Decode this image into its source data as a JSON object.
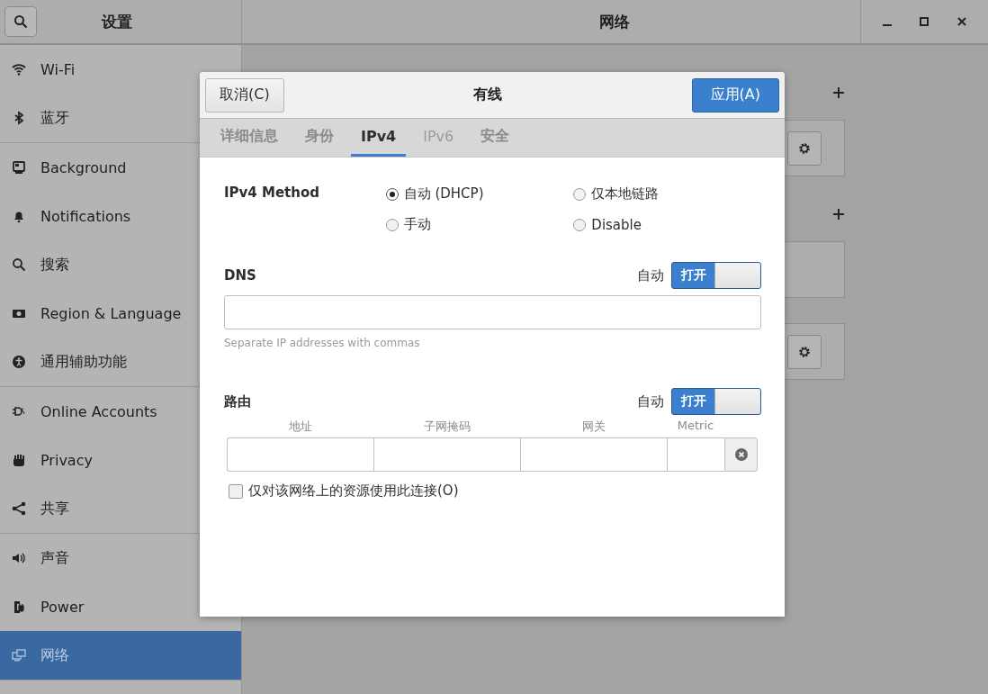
{
  "window": {
    "sidebar_title": "设置",
    "title": "网络"
  },
  "sidebar": {
    "groups": [
      [
        {
          "label": "Wi-Fi",
          "selected": false
        },
        {
          "label": "蓝牙",
          "selected": false
        }
      ],
      [
        {
          "label": "Background",
          "selected": false
        },
        {
          "label": "Notifications",
          "selected": false
        },
        {
          "label": "搜索",
          "selected": false
        },
        {
          "label": "Region & Language",
          "selected": false
        },
        {
          "label": "通用辅助功能",
          "selected": false
        }
      ],
      [
        {
          "label": "Online Accounts",
          "selected": false
        },
        {
          "label": "Privacy",
          "selected": false
        },
        {
          "label": "共享",
          "selected": false
        }
      ],
      [
        {
          "label": "声音",
          "selected": false
        },
        {
          "label": "Power",
          "selected": false
        },
        {
          "label": "网络",
          "selected": true
        }
      ]
    ]
  },
  "dialog": {
    "cancel_button": "取消(C)",
    "title": "有线",
    "apply_button": "应用(A)",
    "tabs": [
      {
        "label": "详细信息",
        "selected": false,
        "disabled": false
      },
      {
        "label": "身份",
        "selected": false,
        "disabled": false
      },
      {
        "label": "IPv4",
        "selected": true,
        "disabled": false
      },
      {
        "label": "IPv6",
        "selected": false,
        "disabled": true
      },
      {
        "label": "安全",
        "selected": false,
        "disabled": false
      }
    ],
    "ipv4_method": {
      "label": "IPv4 Method",
      "options": [
        {
          "label": "自动 (DHCP)",
          "selected": true
        },
        {
          "label": "手动",
          "selected": false
        },
        {
          "label": "仅本地链路",
          "selected": false
        },
        {
          "label": "Disable",
          "selected": false
        }
      ]
    },
    "dns": {
      "label": "DNS",
      "auto_label": "自动",
      "switch": {
        "label": "打开",
        "on": true
      },
      "hint": "Separate IP addresses with commas"
    },
    "routes": {
      "label": "路由",
      "auto_label": "自动",
      "switch": {
        "label": "打开",
        "on": true
      },
      "columns": [
        "地址",
        "子网掩码",
        "网关",
        "Metric"
      ],
      "checkbox": {
        "label": "仅对该网络上的资源使用此连接(O)",
        "checked": false
      }
    }
  }
}
